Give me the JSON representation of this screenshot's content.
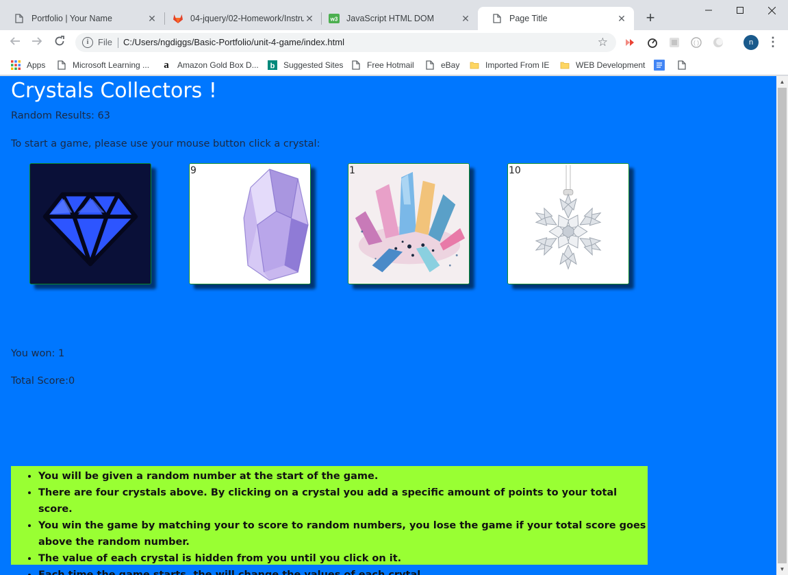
{
  "browser": {
    "tabs": [
      {
        "title": "Portfolio | Your Name",
        "icon": "page-icon"
      },
      {
        "title": "04-jquery/02-Homework/Instru",
        "icon": "gitlab-icon"
      },
      {
        "title": "JavaScript HTML DOM",
        "icon": "w3schools-icon"
      },
      {
        "title": "Page Title",
        "icon": "page-icon",
        "active": true
      }
    ],
    "omnibox": {
      "scheme_label": "File",
      "url": "C:/Users/ngdiggs/Basic-Portfolio/unit-4-game/index.html"
    },
    "profile_initial": "n",
    "bookmarks": [
      {
        "label": "Apps",
        "icon": "apps-grid-icon"
      },
      {
        "label": "Microsoft Learning ...",
        "icon": "page-icon"
      },
      {
        "label": "Amazon Gold Box D...",
        "icon": "amazon-icon"
      },
      {
        "label": "Suggested Sites",
        "icon": "bing-icon"
      },
      {
        "label": "Free Hotmail",
        "icon": "page-icon"
      },
      {
        "label": "eBay",
        "icon": "page-icon"
      },
      {
        "label": "Imported From IE",
        "icon": "folder-icon"
      },
      {
        "label": "WEB Development",
        "icon": "folder-icon"
      },
      {
        "label": "",
        "icon": "docs-icon"
      },
      {
        "label": "",
        "icon": "page-icon"
      }
    ]
  },
  "page": {
    "title": "Crystals Collectors !",
    "random_results": "Random Results: 63",
    "start_prompt": "To start a game, please use your mouse button click a crystal:",
    "crystals": [
      {
        "value": "",
        "image": "blue-diamond"
      },
      {
        "value": "9",
        "image": "purple-crystal"
      },
      {
        "value": "1",
        "image": "crystal-cluster"
      },
      {
        "value": "10",
        "image": "snowflake-ornament"
      }
    ],
    "you_won": "You won: 1",
    "total_score": "Total Score:0",
    "instructions": [
      "You will be given a random number at the start of the game.",
      "There are four crystals above. By clicking on a crystal you add a specific amount of points to your total score.",
      "You win the game by matching your to score to random numbers, you lose the game if your total score goes above the random number.",
      "The value of each crystal is hidden from you until you click on it.",
      "Each time the game starts, the will change the values of each crytal."
    ]
  },
  "colors": {
    "page_background": "#0077ff",
    "instructions_background": "#99ff33",
    "crystal_border": "#0a8a2c"
  }
}
